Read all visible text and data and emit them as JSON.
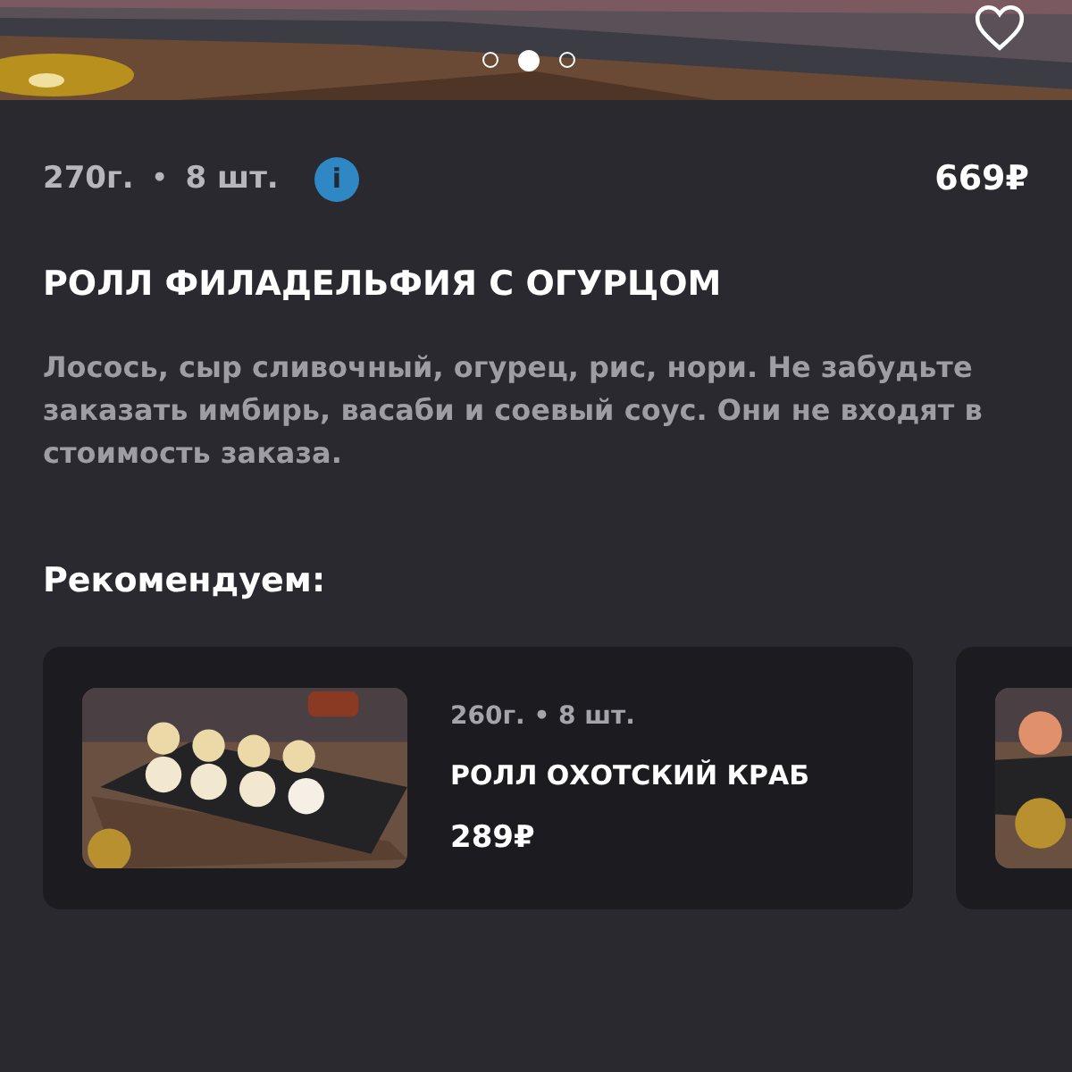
{
  "gallery": {
    "dots": [
      {
        "selected": false
      },
      {
        "selected": true
      },
      {
        "selected": false
      }
    ],
    "favorite": false
  },
  "product": {
    "weight": "270г.",
    "separator": "•",
    "count": "8 шт.",
    "info": "i",
    "price": "669₽",
    "name": "РОЛЛ ФИЛАДЕЛЬФИЯ С ОГУРЦОМ",
    "description": "Лосось, сыр сливочный, огурец, рис, нори. Не забудьте заказать имбирь, васаби и соевый соус. Они не входят в стоимость заказа."
  },
  "recommendations": {
    "title": "Рекомендуем:",
    "items": [
      {
        "kind": "product",
        "meta": "260г. • 8 шт.",
        "name": "РОЛЛ ОХОТСКИЙ КРАБ",
        "price": "289₽"
      },
      {
        "kind": "picture"
      }
    ]
  }
}
